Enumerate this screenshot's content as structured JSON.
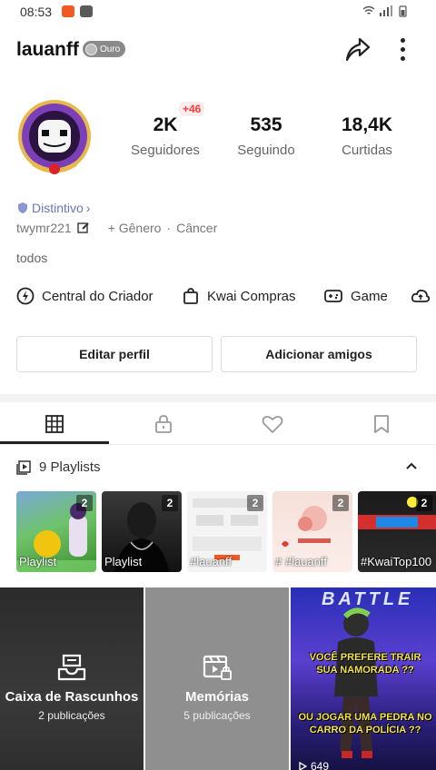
{
  "status_bar": {
    "time": "08:53"
  },
  "profile": {
    "username": "lauanff",
    "level_badge": "Ouro",
    "stats": [
      {
        "value": "2K",
        "label": "Seguidores",
        "delta": "+46"
      },
      {
        "value": "535",
        "label": "Seguindo"
      },
      {
        "value": "18,4K",
        "label": "Curtidas"
      }
    ],
    "distintivo": "Distintivo",
    "handle": "twymr221",
    "gender": "+ Gênero",
    "sign": "Câncer",
    "bio": "todos"
  },
  "shortcuts": [
    {
      "label": "Central do Criador",
      "icon": "lightning-circle-icon"
    },
    {
      "label": "Kwai Compras",
      "icon": "shopping-bag-icon"
    },
    {
      "label": "Game",
      "icon": "gamepad-icon"
    }
  ],
  "buttons": {
    "edit": "Editar perfil",
    "add": "Adicionar amigos"
  },
  "tabs": [
    "grid",
    "lock",
    "heart",
    "bookmark"
  ],
  "playlists": {
    "header": "9 Playlists",
    "items": [
      {
        "count": "2",
        "caption": "Playlist"
      },
      {
        "count": "2",
        "caption": "Playlist"
      },
      {
        "count": "2",
        "caption": "#lauanff"
      },
      {
        "count": "2",
        "caption": "# #lauanff"
      },
      {
        "count": "2",
        "caption": "#KwaiTop100"
      }
    ]
  },
  "grid": {
    "drafts": {
      "title": "Caixa de Rascunhos",
      "sub": "2 publicações"
    },
    "memories": {
      "title": "Memórias",
      "sub": "5 publicações"
    },
    "video": {
      "overlay_top": "BATTLE",
      "text1": "VOCÊ PREFERE TRAIR SUA NAMORADA ??",
      "text2": "OU JOGAR UMA PEDRA NO CARRO DA POLÍCIA ??",
      "views": "649"
    }
  },
  "colors": {
    "accent_red": "#ff3b3b",
    "distintivo": "#6a78b8"
  }
}
